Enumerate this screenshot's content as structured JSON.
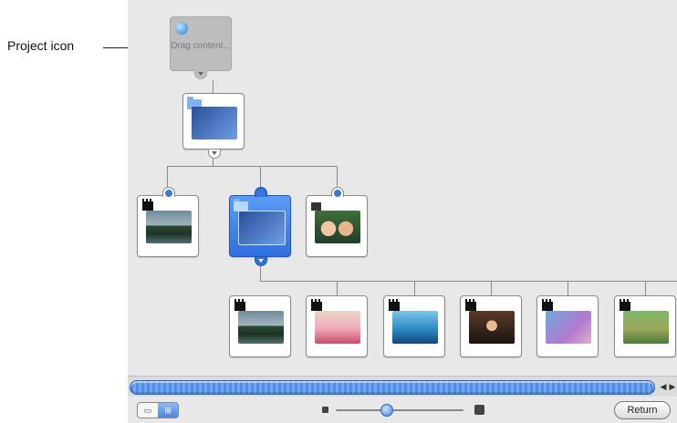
{
  "callout": {
    "label": "Project icon"
  },
  "project": {
    "drag_text": "Drag content..."
  },
  "scrollbar": {
    "left_arrow": "◀",
    "right_arrow": "▶"
  },
  "toolbar": {
    "view_tree_icon": "tree-view-icon",
    "view_list_icon": "list-view-icon",
    "zoom_level": 0.4,
    "return_label": "Return"
  },
  "colors": {
    "selection_blue": "#2f6fe0",
    "canvas_bg": "#e8e8e8",
    "project_grey": "#bdbdbd"
  }
}
